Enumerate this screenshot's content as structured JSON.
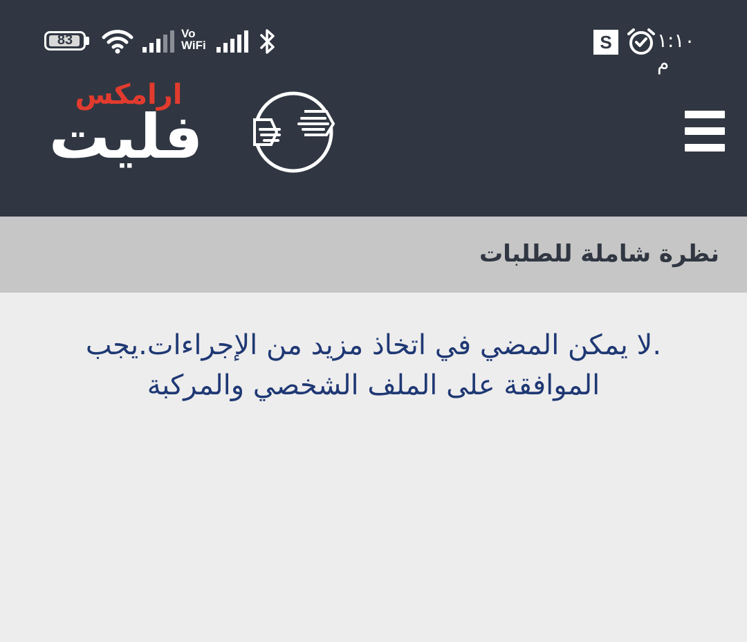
{
  "status_bar": {
    "battery_level": "83",
    "network_label": "Vo WiFi",
    "app_badge": "S",
    "time": "١:١٠ م"
  },
  "header": {
    "logo": {
      "top_text": "ارامكس",
      "main_text": "فليت"
    },
    "menu_icon": "hamburger-icon"
  },
  "page": {
    "title": "نظرة شاملة للطلبات",
    "message_line1": ".لا يمكن المضي في اتخاذ مزيد من الإجراءات.يجب",
    "message_line2": "الموافقة على الملف الشخصي والمركبة"
  },
  "colors": {
    "header_bg": "#303742",
    "title_bar_bg": "#c6c6c6",
    "page_bg": "#ededed",
    "logo_accent": "#e23b2e",
    "message_text": "#1f3874"
  }
}
